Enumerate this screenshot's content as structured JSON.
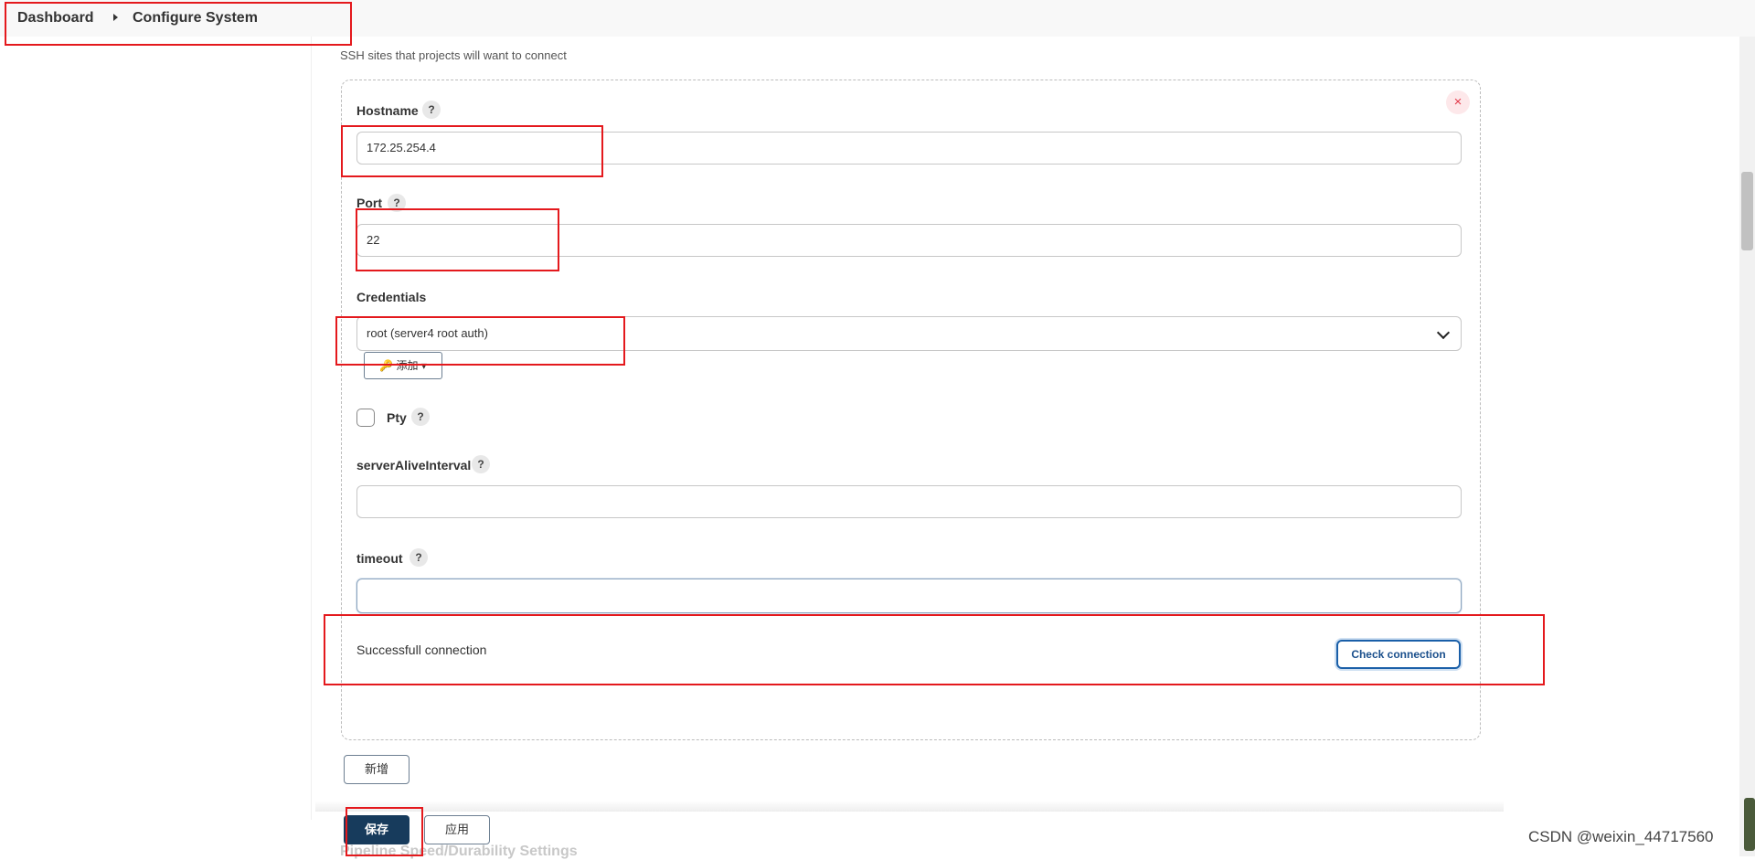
{
  "breadcrumb": {
    "home": "Dashboard",
    "current": "Configure System"
  },
  "section": {
    "description": "SSH sites that projects will want to connect"
  },
  "ssh_site": {
    "hostname": {
      "label": "Hostname",
      "value": "172.25.254.4"
    },
    "port": {
      "label": "Port",
      "value": "22"
    },
    "credentials": {
      "label": "Credentials",
      "selected": "root (server4 root auth)",
      "add_label": "🔑 添加 ▾"
    },
    "pty": {
      "label": "Pty",
      "checked": false
    },
    "server_alive_interval": {
      "label": "serverAliveInterval",
      "value": ""
    },
    "timeout": {
      "label": "timeout",
      "value": ""
    },
    "status_text": "Successfull connection",
    "check_label": "Check connection",
    "help_glyph": "?",
    "close_glyph": "×"
  },
  "actions": {
    "add_label": "新增",
    "save_label": "保存",
    "apply_label": "应用"
  },
  "next_section": "Pipeline Speed/Durability Settings",
  "watermark": "CSDN @weixin_44717560",
  "colors": {
    "annotation": "#e4191d",
    "primary": "#173b5c",
    "link": "#1a5fa8"
  }
}
